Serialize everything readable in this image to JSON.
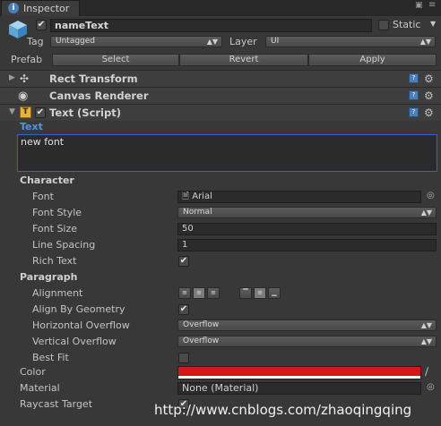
{
  "tab": {
    "title": "Inspector"
  },
  "header": {
    "name": "nameText",
    "static_label": "Static",
    "tag_label": "Tag",
    "tag_value": "Untagged",
    "layer_label": "Layer",
    "layer_value": "UI"
  },
  "prefab": {
    "label": "Prefab",
    "select": "Select",
    "revert": "Revert",
    "apply": "Apply"
  },
  "components": {
    "rect_transform": "Rect Transform",
    "canvas_renderer": "Canvas Renderer",
    "text_script": "Text (Script)"
  },
  "text_section": {
    "label": "Text",
    "value": "new font"
  },
  "character": {
    "header": "Character",
    "font_label": "Font",
    "font_value": "Arial",
    "font_style_label": "Font Style",
    "font_style_value": "Normal",
    "font_size_label": "Font Size",
    "font_size_value": "50",
    "line_spacing_label": "Line Spacing",
    "line_spacing_value": "1",
    "rich_text_label": "Rich Text"
  },
  "paragraph": {
    "header": "Paragraph",
    "alignment_label": "Alignment",
    "align_by_geometry_label": "Align By Geometry",
    "horizontal_overflow_label": "Horizontal Overflow",
    "horizontal_overflow_value": "Overflow",
    "vertical_overflow_label": "Vertical Overflow",
    "vertical_overflow_value": "Overflow",
    "best_fit_label": "Best Fit"
  },
  "bottom": {
    "color_label": "Color",
    "color_value": "#d01a1a",
    "material_label": "Material",
    "material_value": "None (Material)",
    "raycast_label": "Raycast Target"
  },
  "watermark": "http://www.cnblogs.com/zhaoqingqing",
  "colors": {
    "accent": "#3a5fcd",
    "panel": "#383838",
    "field": "#2b2b2b"
  }
}
